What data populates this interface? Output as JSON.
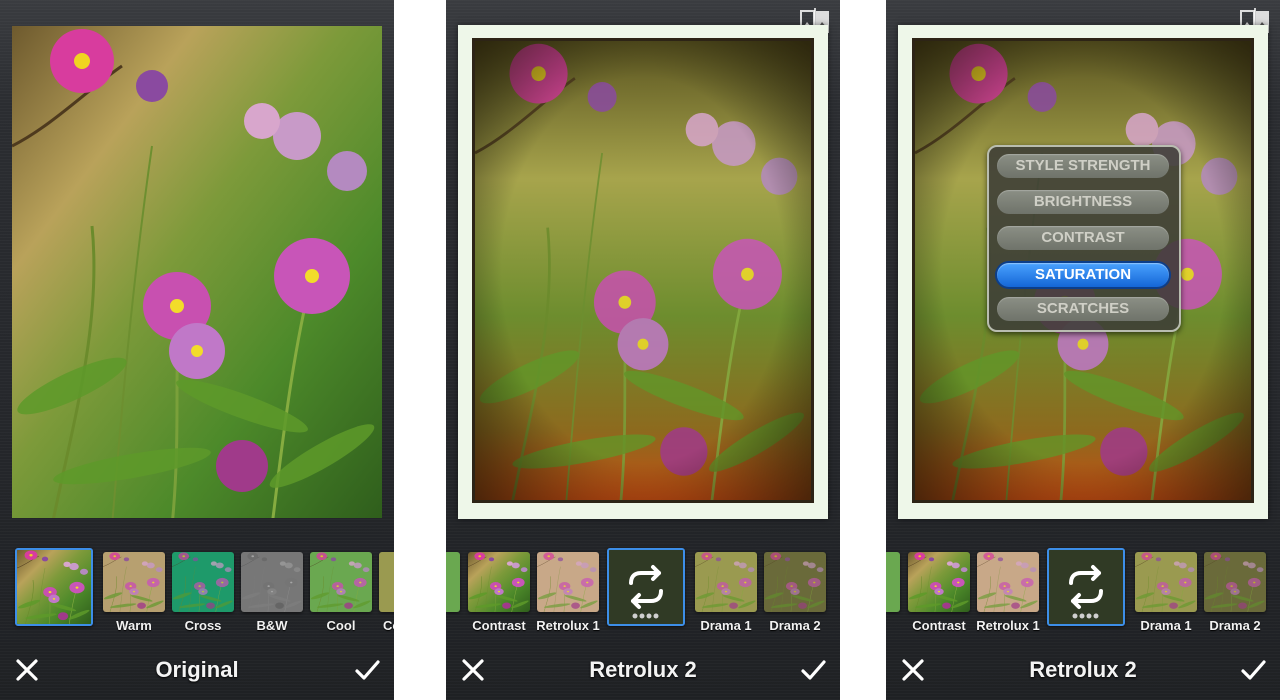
{
  "panels": [
    {
      "title": "Original",
      "filters": [
        "Warm",
        "Cross",
        "B&W",
        "Cool",
        "Co"
      ]
    },
    {
      "title": "Retrolux 2",
      "filters": [
        "Contrast",
        "Retrolux 1",
        "Drama 1",
        "Drama 2"
      ]
    },
    {
      "title": "Retrolux 2",
      "filters": [
        "Contrast",
        "Retrolux 1",
        "Drama 1",
        "Drama 2"
      ],
      "menu": [
        "STYLE STRENGTH",
        "BRIGHTNESS",
        "CONTRAST",
        "SATURATION",
        "SCRATCHES"
      ],
      "menu_active": "SATURATION"
    }
  ],
  "icons": {
    "cancel": "close-icon",
    "apply": "checkmark-icon",
    "compare": "compare-icon",
    "refresh": "refresh-icon"
  },
  "colors": {
    "selection": "#3d8ee8",
    "menu_active": "#1466d6",
    "frame": "#eef7e9"
  }
}
